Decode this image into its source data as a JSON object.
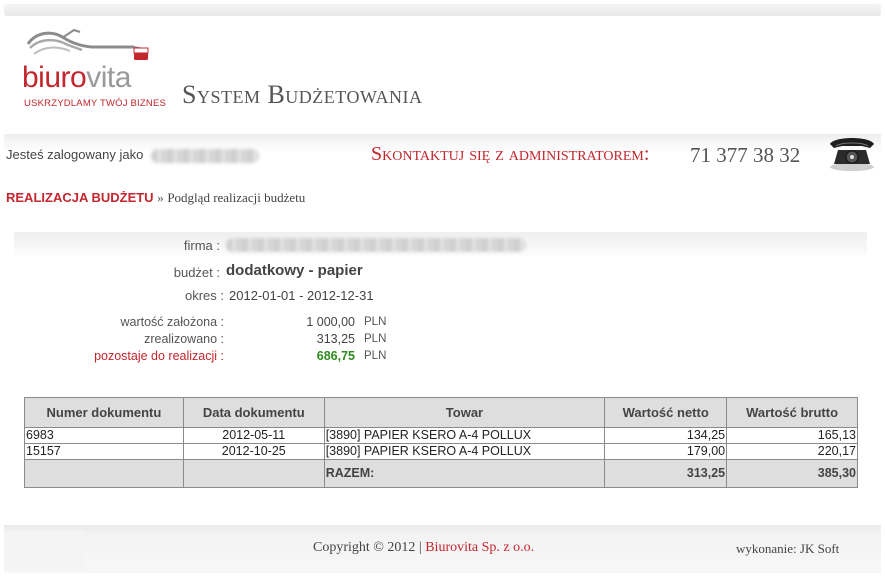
{
  "logo": {
    "brand_a": "biuro",
    "brand_b": "vita",
    "tagline": "USKRZYDLAMY TWÓJ BIZNES"
  },
  "header": {
    "title": "System Budżetowania"
  },
  "user_bar": {
    "logged_label": "Jesteś zalogowany jako",
    "contact_label": "Skontaktuj się z administratorem:",
    "phone": "71 377 38 32"
  },
  "breadcrumb": {
    "main": "REALIZACJA BUDŻETU",
    "separator": "»",
    "sub": "Podgląd realizacji budżetu"
  },
  "details": {
    "firma_label": "firma :",
    "budzet_label": "budżet :",
    "budzet_value": "dodatkowy - papier",
    "okres_label": "okres :",
    "okres_value": "2012-01-01 - 2012-12-31"
  },
  "summary": {
    "planned_label": "wartość założona :",
    "planned_value": "1 000,00",
    "realized_label": "zrealizowano :",
    "realized_value": "313,25",
    "remaining_label": "pozostaje do realizacji :",
    "remaining_value": "686,75",
    "currency": "PLN"
  },
  "table": {
    "headers": [
      "Numer dokumentu",
      "Data dokumentu",
      "Towar",
      "Wartość netto",
      "Wartość brutto"
    ],
    "rows": [
      [
        "6983",
        "2012-05-11",
        "[3890] PAPIER KSERO A-4 POLLUX",
        "134,25",
        "165,13"
      ],
      [
        "15157",
        "2012-10-25",
        "[3890] PAPIER KSERO A-4 POLLUX",
        "179,00",
        "220,17"
      ]
    ],
    "total_label": "RAZEM:",
    "total_netto": "313,25",
    "total_brutto": "385,30"
  },
  "footer": {
    "copyright": "Copyright © 2012 |",
    "company": "Biurovita Sp. z o.o.",
    "made_by": "wykonanie: JK Soft"
  },
  "colors": {
    "accent": "#c3262d",
    "remaining": "#2e8b1e",
    "table_header": "#dedede"
  }
}
